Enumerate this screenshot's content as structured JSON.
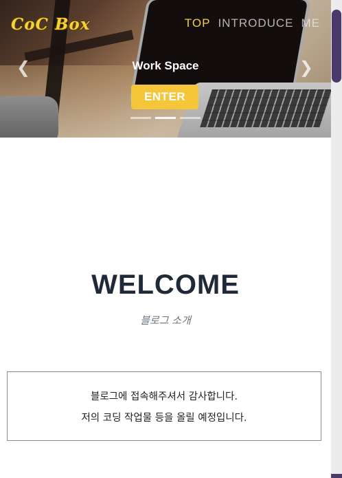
{
  "header": {
    "logo": "CoC Box",
    "nav": [
      "TOP",
      "INTRODUCE",
      "ME"
    ]
  },
  "hero": {
    "title": "Work Space",
    "button_label": "ENTER",
    "prev_icon": "chevron-left-icon",
    "next_icon": "chevron-right-icon",
    "slides": 3,
    "active_slide": 2
  },
  "welcome": {
    "title": "WELCOME",
    "subtitle": "블로그 소개",
    "intro_lines": [
      "블로그에 접속해주셔서 감사합니다.",
      "저의 코딩 작업물 등을 올릴 예정입니다."
    ]
  },
  "colors": {
    "accent": "#f5c63a",
    "logo": "#f5d23c",
    "title": "#1f2a36",
    "scroll_thumb": "#4a3a6a"
  }
}
